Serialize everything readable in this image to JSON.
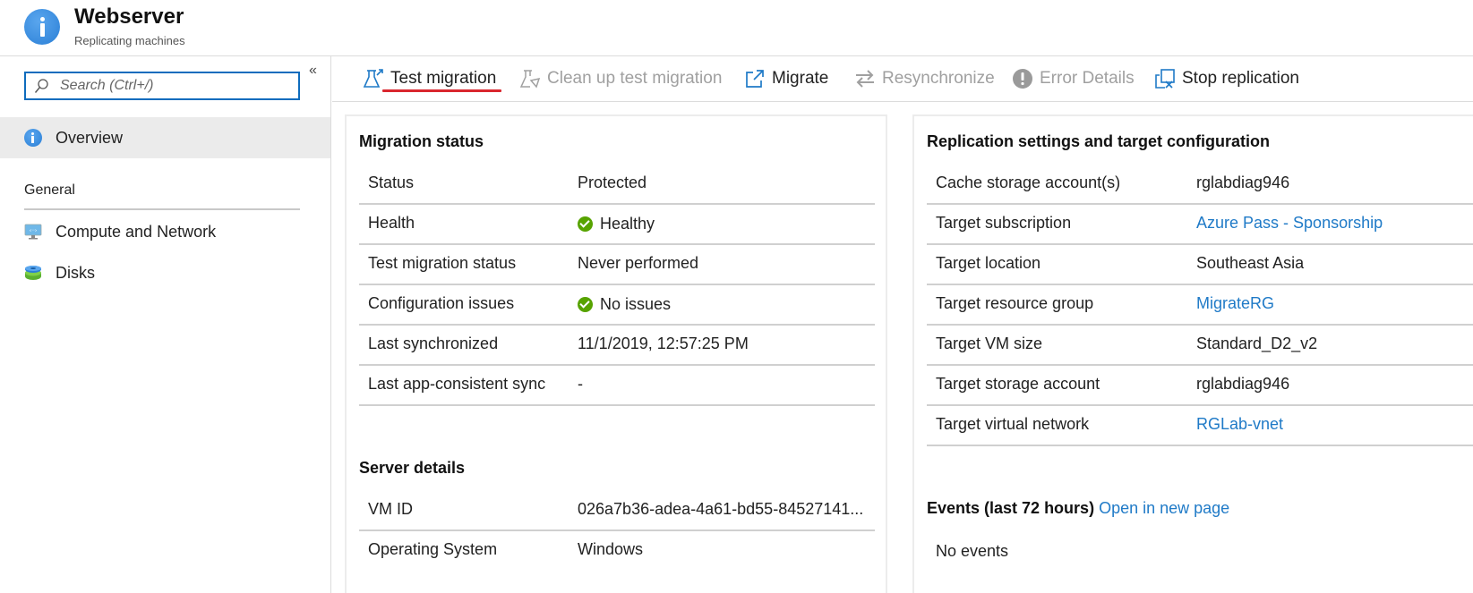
{
  "header": {
    "title": "Webserver",
    "subtitle": "Replicating machines",
    "icon": "info-icon"
  },
  "sidebar": {
    "search_placeholder": "Search (Ctrl+/)",
    "collapse_label": "«",
    "items": [
      {
        "label": "Overview",
        "icon": "info-icon",
        "active": true
      }
    ],
    "section": "General",
    "section_items": [
      {
        "label": "Compute and Network",
        "icon": "monitor-network-icon"
      },
      {
        "label": "Disks",
        "icon": "disks-icon"
      }
    ]
  },
  "toolbar": {
    "buttons": [
      {
        "label": "Test migration",
        "icon": "flask-arrow-icon",
        "enabled": true,
        "highlighted": true
      },
      {
        "label": "Clean up test migration",
        "icon": "flask-cleanup-icon",
        "enabled": false
      },
      {
        "label": "Migrate",
        "icon": "external-link-icon",
        "enabled": true
      },
      {
        "label": "Resynchronize",
        "icon": "sync-arrows-icon",
        "enabled": false
      },
      {
        "label": "Error Details",
        "icon": "error-exclamation-icon",
        "enabled": false
      },
      {
        "label": "Stop replication",
        "icon": "stop-replication-icon",
        "enabled": true
      }
    ],
    "highlight_color": "#d9262e"
  },
  "migration_status": {
    "title": "Migration status",
    "rows": [
      {
        "key": "Status",
        "value": "Protected"
      },
      {
        "key": "Health",
        "value": "Healthy",
        "status_icon": "check-circle-icon"
      },
      {
        "key": "Test migration status",
        "value": "Never performed"
      },
      {
        "key": "Configuration issues",
        "value": "No issues",
        "status_icon": "check-circle-icon"
      },
      {
        "key": "Last synchronized",
        "value": "11/1/2019, 12:57:25 PM"
      },
      {
        "key": "Last app-consistent sync",
        "value": "-"
      }
    ]
  },
  "server_details": {
    "title": "Server details",
    "rows": [
      {
        "key": "VM ID",
        "value": "026a7b36-adea-4a61-bd55-84527141..."
      },
      {
        "key": "Operating System",
        "value": "Windows"
      }
    ]
  },
  "replication_settings": {
    "title": "Replication settings and target configuration",
    "rows": [
      {
        "key": "Cache storage account(s)",
        "value": "rglabdiag946",
        "link": false
      },
      {
        "key": "Target subscription",
        "value": "Azure Pass - Sponsorship",
        "link": true
      },
      {
        "key": "Target location",
        "value": "Southeast Asia",
        "link": false
      },
      {
        "key": "Target resource group",
        "value": "MigrateRG",
        "link": true
      },
      {
        "key": "Target VM size",
        "value": "Standard_D2_v2",
        "link": false
      },
      {
        "key": "Target storage account",
        "value": "rglabdiag946",
        "link": false
      },
      {
        "key": "Target virtual network",
        "value": "RGLab-vnet",
        "link": true
      }
    ]
  },
  "events": {
    "title": "Events (last 72 hours)",
    "link_label": "Open in new page",
    "empty_text": "No events"
  },
  "colors": {
    "accent": "#0f6cbd",
    "link": "#1f7ac7",
    "success": "#57a300",
    "disabled": "#a0a0a0"
  }
}
